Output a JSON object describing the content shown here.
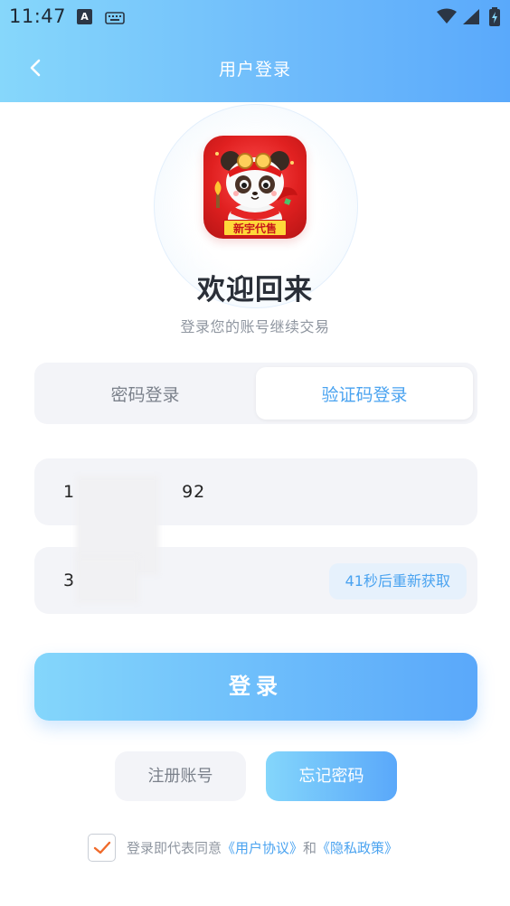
{
  "status_bar": {
    "time": "11:47",
    "input_badge": "A",
    "icons": [
      "keyboard-icon",
      "wifi-icon",
      "signal-icon",
      "battery-charging-icon"
    ]
  },
  "header": {
    "title": "用户登录",
    "back_icon": "chevron-left-icon",
    "gradient_colors": [
      "#86d7fb",
      "#5aa9fb"
    ]
  },
  "logo": {
    "caption": "新宇代售"
  },
  "welcome": {
    "title": "欢迎回来",
    "subtitle": "登录您的账号继续交易"
  },
  "tabs": [
    {
      "label": "密码登录",
      "active": false
    },
    {
      "label": "验证码登录",
      "active": true
    }
  ],
  "form": {
    "phone_prefix": "1",
    "phone_suffix": "92",
    "code_prefix": "3",
    "resend_label": "41秒后重新获取"
  },
  "buttons": {
    "login": "登录",
    "register": "注册账号",
    "forgot": "忘记密码"
  },
  "agreement": {
    "checked": true,
    "prefix": "登录即代表同意",
    "user_agreement": "《用户协议》",
    "and": "和",
    "privacy_policy": "《隐私政策》"
  },
  "colors": {
    "accent": "#4aa3f0",
    "field_bg": "#f3f4f8",
    "check": "#f06a2a"
  }
}
